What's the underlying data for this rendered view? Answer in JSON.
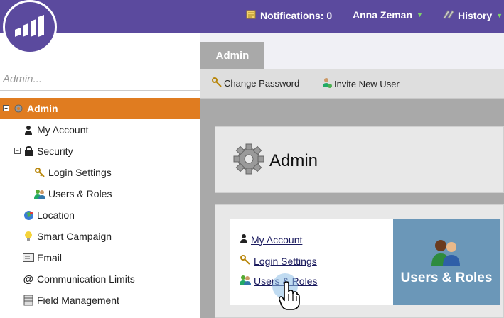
{
  "topbar": {
    "notifications_label": "Notifications: 0",
    "user_name": "Anna Zeman",
    "history_label": "History"
  },
  "sidebar": {
    "search_placeholder": "Admin...",
    "items": [
      {
        "label": "Admin",
        "icon": "gear-icon",
        "active": true
      },
      {
        "label": "My Account",
        "icon": "person-icon"
      },
      {
        "label": "Security",
        "icon": "lock-icon"
      },
      {
        "label": "Login Settings",
        "icon": "keys-icon"
      },
      {
        "label": "Users & Roles",
        "icon": "users-icon"
      },
      {
        "label": "Location",
        "icon": "globe-icon"
      },
      {
        "label": "Smart Campaign",
        "icon": "lightbulb-icon"
      },
      {
        "label": "Email",
        "icon": "envelope-icon"
      },
      {
        "label": "Communication Limits",
        "icon": "at-sign-icon"
      },
      {
        "label": "Field Management",
        "icon": "database-icon"
      }
    ]
  },
  "main": {
    "tab_label": "Admin",
    "toolbar": {
      "change_password": "Change Password",
      "invite_new_user": "Invite New User"
    },
    "header_title": "Admin",
    "links": [
      {
        "label": "My Account",
        "icon": "person-icon"
      },
      {
        "label": "Login Settings",
        "icon": "keys-icon"
      },
      {
        "label": "Users & Roles",
        "icon": "users-icon"
      }
    ],
    "tile_label": "Users & Roles"
  },
  "colors": {
    "topbar": "#5b4a9e",
    "active_item": "#e07c20",
    "tile": "#6b97b8"
  }
}
